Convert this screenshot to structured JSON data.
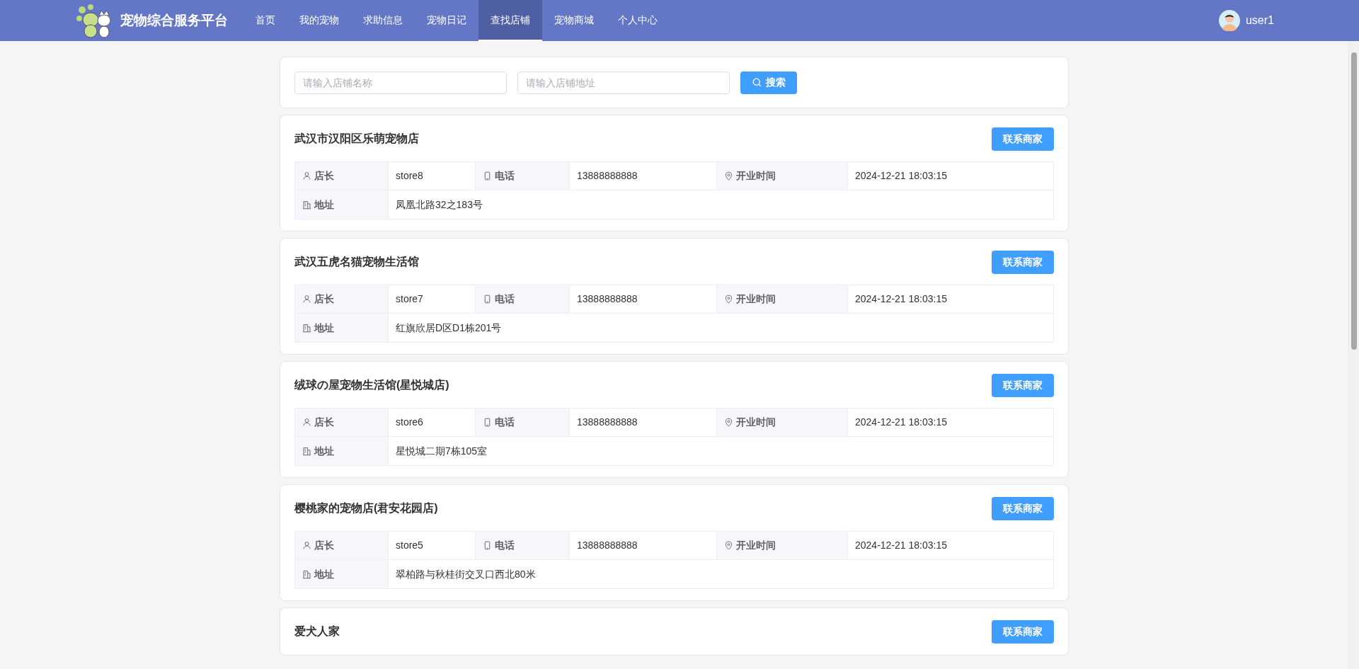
{
  "header": {
    "brand": "宠物综合服务平台",
    "nav": [
      {
        "label": "首页",
        "selected": false
      },
      {
        "label": "我的宠物",
        "selected": false
      },
      {
        "label": "求助信息",
        "selected": false
      },
      {
        "label": "宠物日记",
        "selected": false
      },
      {
        "label": "查找店铺",
        "selected": true
      },
      {
        "label": "宠物商城",
        "selected": false
      },
      {
        "label": "个人中心",
        "selected": false
      }
    ],
    "user": "user1"
  },
  "search": {
    "name_placeholder": "请输入店铺名称",
    "address_placeholder": "请输入店铺地址",
    "button": "搜索"
  },
  "stores": [
    {
      "name": "武汉市汉阳区乐萌宠物店",
      "button": "联系商家",
      "owner_label": "店长",
      "owner": "store8",
      "phone_label": "电话",
      "phone": "13888888888",
      "time_label": "开业时间",
      "time": "2024-12-21 18:03:15",
      "address_label": "地址",
      "address": "凤凰北路32之183号"
    },
    {
      "name": "武汉五虎名猫宠物生活馆",
      "button": "联系商家",
      "owner_label": "店长",
      "owner": "store7",
      "phone_label": "电话",
      "phone": "13888888888",
      "time_label": "开业时间",
      "time": "2024-12-21 18:03:15",
      "address_label": "地址",
      "address": "红旗欣居D区D1栋201号"
    },
    {
      "name": "绒球の屋宠物生活馆(星悦城店)",
      "button": "联系商家",
      "owner_label": "店长",
      "owner": "store6",
      "phone_label": "电话",
      "phone": "13888888888",
      "time_label": "开业时间",
      "time": "2024-12-21 18:03:15",
      "address_label": "地址",
      "address": "星悦城二期7栋105室"
    },
    {
      "name": "樱桃家的宠物店(君安花园店)",
      "button": "联系商家",
      "owner_label": "店长",
      "owner": "store5",
      "phone_label": "电话",
      "phone": "13888888888",
      "time_label": "开业时间",
      "time": "2024-12-21 18:03:15",
      "address_label": "地址",
      "address": "翠柏路与秋桂街交叉口西北80米"
    },
    {
      "name": "爱犬人家",
      "button": "联系商家"
    }
  ]
}
